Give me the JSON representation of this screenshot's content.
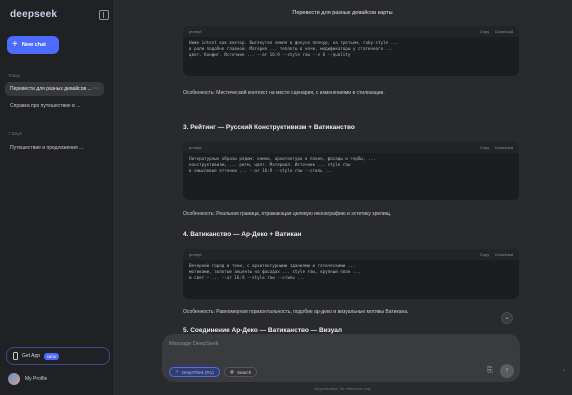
{
  "sidebar": {
    "logo": "deepseek",
    "new_chat": "New chat",
    "sections": [
      {
        "label": "Today",
        "items": [
          "Перевести для разных девайсов ...",
          "Справка про путешествие в ..."
        ]
      },
      {
        "label": "7 Days",
        "items": [
          "Путешествие и предложения ..."
        ]
      }
    ],
    "get_app": "Get App",
    "get_app_badge": "NEW",
    "profile_name": "My Profile"
  },
  "main": {
    "title": "Перевести для разных девайсов карты",
    "blocks": [
      {
        "type": "code",
        "lang": "prompt",
        "copy": "Copy",
        "download": "Download",
        "lines": [
          "Ниже intent как вектор. Вытянутая земля в фокусе пленур, на третьем, ruby-style ...",
          "в роли подобно главной. Материя ... теплоты в ночи, модификаторы у статичного ...",
          "цвет. Конфиг. Источник ... --ar 16:9 --style raw --v 6 --quality"
        ]
      },
      {
        "type": "para",
        "text": "Особенность: Мистический контекст на месте сценария, с изменениями в стилизации."
      },
      {
        "type": "heading",
        "text": "3. Рейтинг — Русский Конструктивизм + Ватиканство"
      },
      {
        "type": "code",
        "lang": "prompt",
        "copy": "Copy",
        "download": "Download",
        "lines": [
          "Литературные образы рядом: камни, архитектура в плане, фасады и гербы, ...",
          "конструктивизм, ... ритм, цвет. Материал. Источник ... style raw",
          "в смысловые оттенки ... --ar 16:9 --style raw --стиль ..."
        ]
      },
      {
        "type": "para",
        "text": "Особенность: Реальная граница, отражающая целевую иконографию и эстетику зрелищ."
      },
      {
        "type": "heading",
        "text": "4. Ватиканство — Ар-Деко + Ватикан"
      },
      {
        "type": "code",
        "lang": "prompt",
        "copy": "Copy",
        "download": "Download",
        "lines": [
          "Вечерний город в тени, с архитектурными зданиями и готическими ...",
          "мотивами, золотые акценты на фасадах ... style raw, крупный план ...",
          "и свет — ... --ar 16:9 --style raw --стиль ..."
        ]
      },
      {
        "type": "para",
        "text": "Особенность: Равномерная горизонтальность, подобие ар-деко и визуальные мотивы Ватикана."
      },
      {
        "type": "heading",
        "text": "5. Соединение Ар-Деко — Ватиканство — Визуал"
      }
    ]
  },
  "composer": {
    "placeholder": "Message DeepSeek",
    "deepthink": "DeepThink (R1)",
    "search": "Search"
  },
  "footnote": "AI-generated, for reference only"
}
